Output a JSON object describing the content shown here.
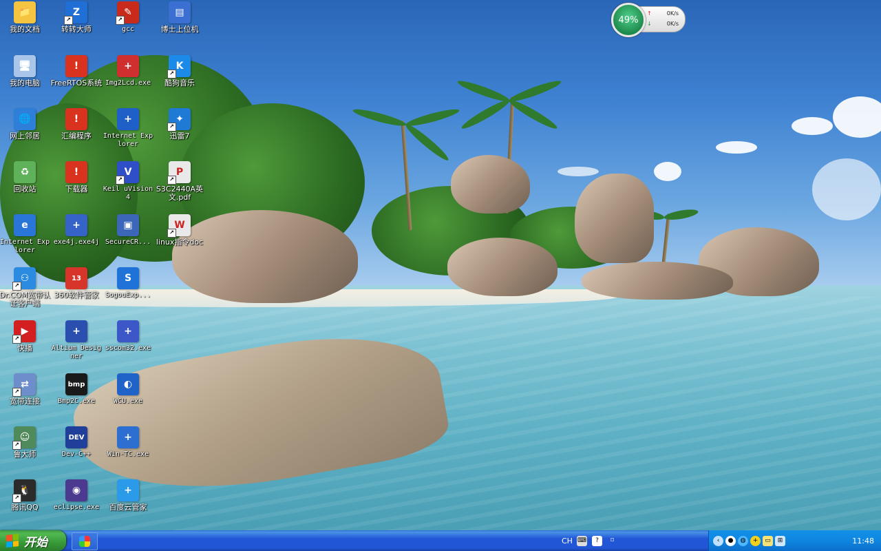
{
  "desktop": {
    "icons": [
      {
        "label": "我的文档",
        "glyph": "📁",
        "bg": "#f5c542",
        "shortcut": false
      },
      {
        "label": "转转大师",
        "glyph": "Z",
        "bg": "#1f6fd6",
        "shortcut": true
      },
      {
        "label": "gcc",
        "glyph": "✎",
        "bg": "#c82a1c",
        "shortcut": true
      },
      {
        "label": "博士上位机",
        "glyph": "▤",
        "bg": "#3b6fd1",
        "shortcut": false
      },
      {
        "label": "我的电脑",
        "glyph": "🖥",
        "bg": "#a9c6ea",
        "shortcut": false
      },
      {
        "label": "FreeRTOS系统",
        "glyph": "!",
        "bg": "#d9331f",
        "shortcut": false
      },
      {
        "label": "Img2Lcd.exe",
        "glyph": "+",
        "bg": "#cf2f2f",
        "shortcut": false
      },
      {
        "label": "酷狗音乐",
        "glyph": "K",
        "bg": "#1c8ae8",
        "shortcut": true
      },
      {
        "label": "网上邻居",
        "glyph": "🌐",
        "bg": "#2d7fd8",
        "shortcut": false
      },
      {
        "label": "汇编程序",
        "glyph": "!",
        "bg": "#d9331f",
        "shortcut": false
      },
      {
        "label": "Internet Explorer",
        "glyph": "+",
        "bg": "#1f5fc8",
        "shortcut": false
      },
      {
        "label": "迅雷7",
        "glyph": "✦",
        "bg": "#1f7ad6",
        "shortcut": true
      },
      {
        "label": "回收站",
        "glyph": "♻",
        "bg": "#5fb15a",
        "shortcut": false
      },
      {
        "label": "下载器",
        "glyph": "!",
        "bg": "#d9331f",
        "shortcut": false
      },
      {
        "label": "Keil uVision4",
        "glyph": "V",
        "bg": "#2f4fc8",
        "shortcut": true
      },
      {
        "label": "S3C2440A英文.pdf",
        "glyph": "P",
        "bg": "#e9e9e9",
        "shortcut": true
      },
      {
        "label": "Internet Explorer",
        "glyph": "e",
        "bg": "#2a76d8",
        "shortcut": false
      },
      {
        "label": "exe4j.exe4j",
        "glyph": "+",
        "bg": "#3563c7",
        "shortcut": false
      },
      {
        "label": "SecureCR...",
        "glyph": "▣",
        "bg": "#3c66b8",
        "shortcut": false
      },
      {
        "label": "linux指令doc",
        "glyph": "W",
        "bg": "#e9e9e9",
        "shortcut": true
      },
      {
        "label": "Dr.COM宽带认证客户端",
        "glyph": "⚇",
        "bg": "#2a8be0",
        "shortcut": true
      },
      {
        "label": "360软件管家",
        "glyph": "13",
        "bg": "#d8352a",
        "shortcut": false
      },
      {
        "label": "SogouExp...",
        "glyph": "S",
        "bg": "#1e72d8",
        "shortcut": false
      },
      {
        "label": "快播",
        "glyph": "▶",
        "bg": "#d31f1f",
        "shortcut": true
      },
      {
        "label": "Altium Designer",
        "glyph": "+",
        "bg": "#2b4fae",
        "shortcut": false
      },
      {
        "label": "sscom32.exe",
        "glyph": "+",
        "bg": "#3b57c8",
        "shortcut": false
      },
      {
        "label": "宽带连接",
        "glyph": "⇄",
        "bg": "#6d8ecb",
        "shortcut": true
      },
      {
        "label": "Bmp2C.exe",
        "glyph": "bmp",
        "bg": "#1a1a1a",
        "shortcut": false
      },
      {
        "label": "WCU.exe",
        "glyph": "◐",
        "bg": "#1f62c8",
        "shortcut": false
      },
      {
        "label": "鲁大师",
        "glyph": "☺",
        "bg": "#4f8a5a",
        "shortcut": true
      },
      {
        "label": "Dev-C++",
        "glyph": "DEV",
        "bg": "#1f3f9a",
        "shortcut": false
      },
      {
        "label": "Win-TC.exe",
        "glyph": "+",
        "bg": "#2d6fd0",
        "shortcut": false
      },
      {
        "label": "腾讯QQ",
        "glyph": "🐧",
        "bg": "#2b2b2b",
        "shortcut": true
      },
      {
        "label": "eclipse.exe",
        "glyph": "◉",
        "bg": "#4b3a8f",
        "shortcut": false
      },
      {
        "label": "百度云管家",
        "glyph": "+",
        "bg": "#2b9ae8",
        "shortcut": false
      }
    ]
  },
  "net_widget": {
    "percent": "49%",
    "upload": "0K/s",
    "download": "0K/s",
    "up_arrow": "↑",
    "down_arrow": "↓"
  },
  "taskbar": {
    "start_label": "开始",
    "language": "CH",
    "clock": "11:48",
    "tray_icons": [
      "keyboard-icon",
      "help-icon",
      "pin-icon",
      "back-arrow-icon",
      "qq-tray-icon",
      "globe-icon",
      "plus-icon",
      "folder-icon",
      "network-icon"
    ]
  }
}
